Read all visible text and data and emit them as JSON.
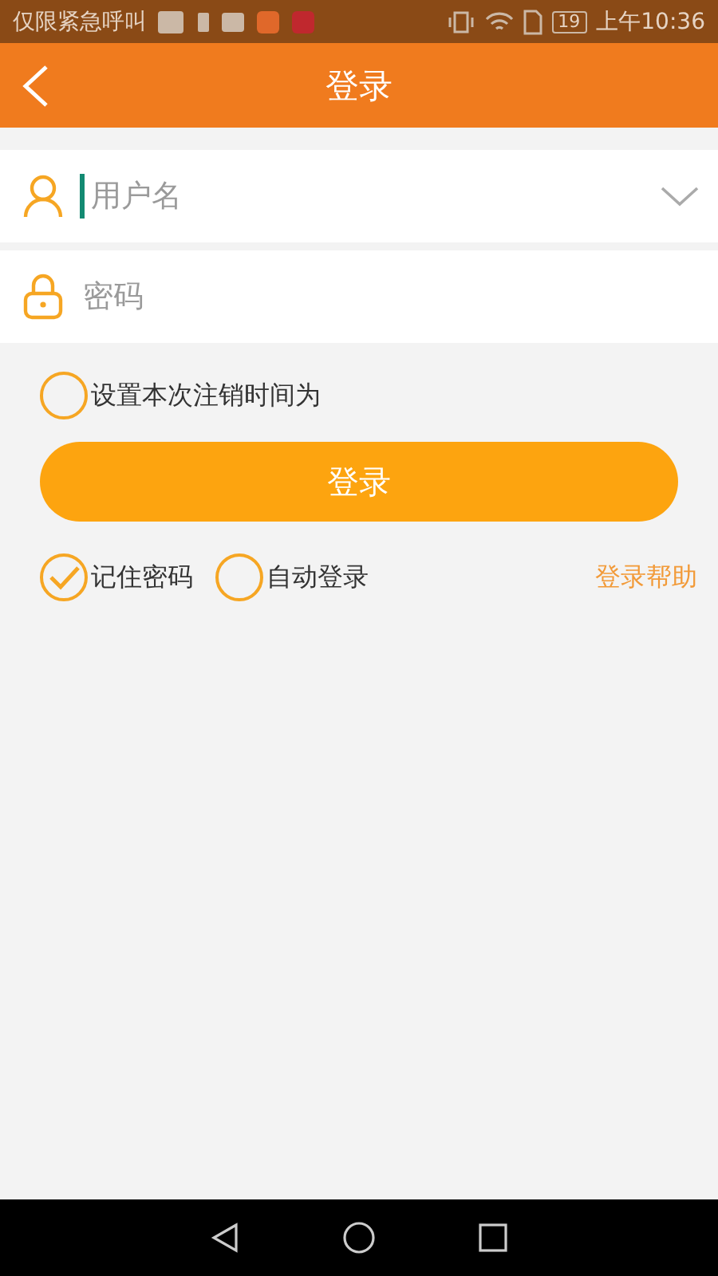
{
  "status_bar": {
    "carrier": "仅限紧急呼叫",
    "battery": "19",
    "time": "上午10:36"
  },
  "header": {
    "title": "登录"
  },
  "username": {
    "placeholder": "用户名"
  },
  "password": {
    "placeholder": "密码"
  },
  "logout_option": {
    "label": "设置本次注销时间为",
    "checked": false
  },
  "login_button": "登录",
  "options": [
    {
      "label": "记住密码",
      "checked": true
    },
    {
      "label": "自动登录",
      "checked": false
    }
  ],
  "help_link": "登录帮助"
}
